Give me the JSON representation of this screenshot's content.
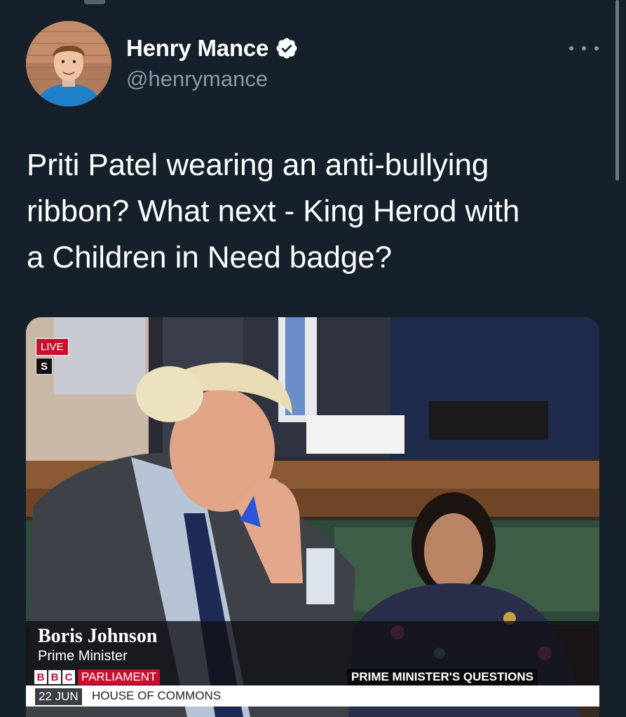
{
  "author": {
    "display_name": "Henry Mance",
    "handle": "@henrymance",
    "verified": true
  },
  "icons": {
    "verified": "verified-badge-icon",
    "more": "more-options-icon"
  },
  "tweet": {
    "text": "Priti Patel wearing an anti-bullying\nribbon? What next - King Herod with\na Children in Need badge?"
  },
  "media": {
    "live_label": "LIVE",
    "channel_badge": "S",
    "lower_third_name": "Boris Johnson",
    "lower_third_title": "Prime Minister",
    "bbc_letters": [
      "B",
      "B",
      "C"
    ],
    "network": "PARLIAMENT",
    "programme": "PRIME MINISTER'S QUESTIONS",
    "date": "22 JUN",
    "location": "HOUSE OF COMMONS"
  },
  "colors": {
    "background": "#15202b",
    "text_secondary": "#8b98a5",
    "verified_badge": "#ffffff",
    "bbc_red": "#c8102e"
  }
}
